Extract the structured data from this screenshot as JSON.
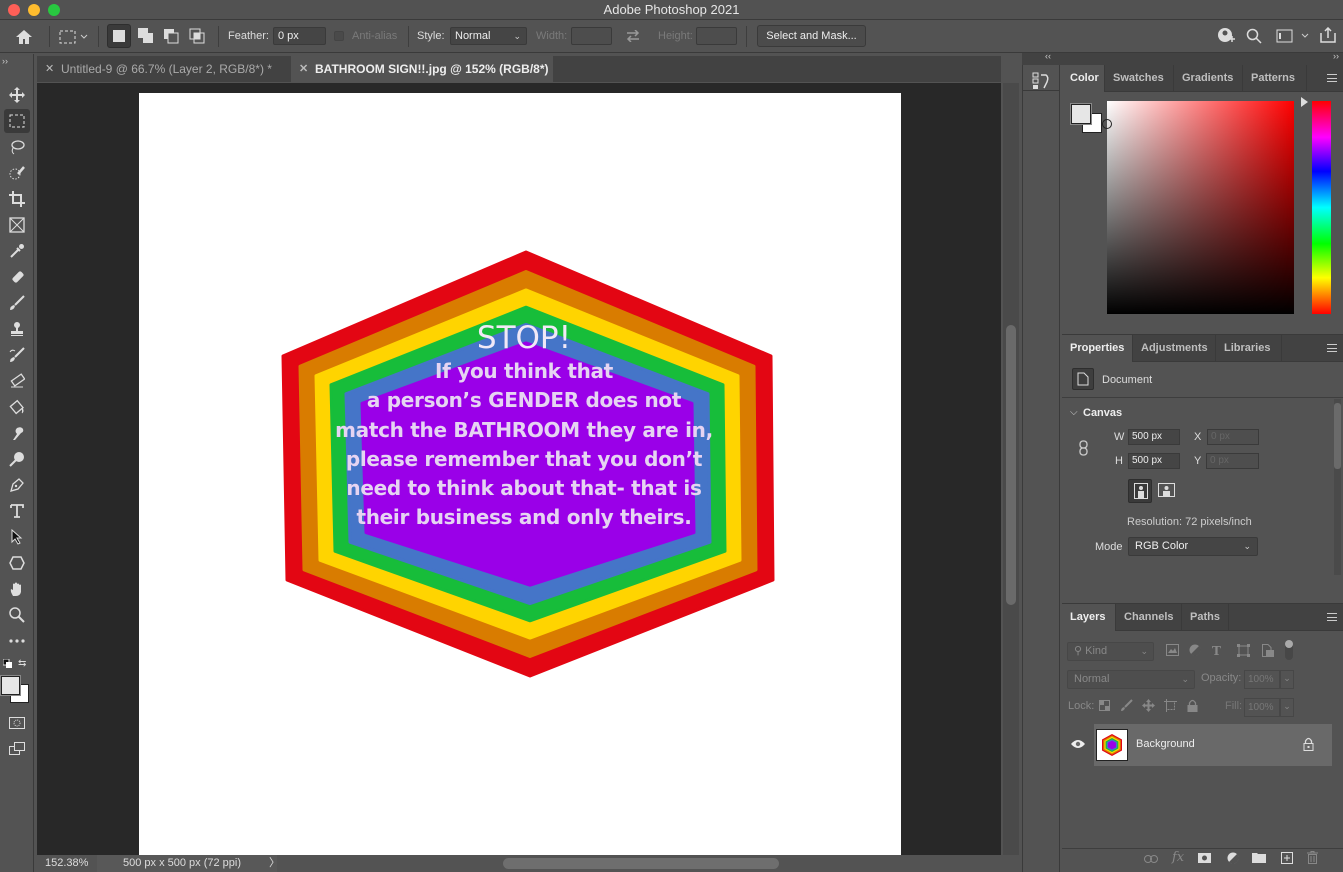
{
  "app": {
    "title": "Adobe Photoshop 2021"
  },
  "options_bar": {
    "feather_label": "Feather:",
    "feather_value": "0 px",
    "anti_alias_label": "Anti-alias",
    "style_label": "Style:",
    "style_value": "Normal",
    "width_label": "Width:",
    "height_label": "Height:",
    "select_mask_label": "Select and Mask..."
  },
  "tabs": [
    {
      "label": "Untitled-9 @ 66.7% (Layer 2, RGB/8*) *",
      "active": false
    },
    {
      "label": "BATHROOM SIGN!!.jpg @ 152% (RGB/8*)",
      "active": true
    }
  ],
  "tools": [
    "move-tool",
    "marquee-tool",
    "lasso-tool",
    "quick-selection-tool",
    "crop-tool",
    "frame-tool",
    "eyedropper-tool",
    "healing-brush-tool",
    "brush-tool",
    "clone-stamp-tool",
    "history-brush-tool",
    "eraser-tool",
    "paint-bucket-tool",
    "smudge-tool",
    "dodge-tool",
    "pen-tool",
    "type-tool",
    "path-selection-tool",
    "shape-tool",
    "hand-tool",
    "zoom-tool",
    "more-tools"
  ],
  "canvas": {
    "heading": "STOP!",
    "lines": [
      "If you think that",
      "a person’s GENDER does not",
      "match the BATHROOM they are in,",
      "please remember that you don’t",
      "need to think about that- that is",
      "their business and only theirs."
    ],
    "ring_colors": [
      "#e30613",
      "#d97c00",
      "#ffd400",
      "#17bd3a",
      "#4575c8",
      "#9a00e8"
    ],
    "text_color": "#e6d4f2"
  },
  "status": {
    "zoom": "152.38%",
    "doc_info": "500 px x 500 px (72 ppi)",
    "arrow": "〉"
  },
  "color_panel": {
    "tabs": [
      "Color",
      "Swatches",
      "Gradients",
      "Patterns"
    ],
    "hue_color": "#ff0000",
    "foreground": "#e6e6e6",
    "background": "#ffffff"
  },
  "properties_panel": {
    "tabs": [
      "Properties",
      "Adjustments",
      "Libraries"
    ],
    "doc_label": "Document",
    "section": "Canvas",
    "w_label": "W",
    "w_value": "500 px",
    "h_label": "H",
    "h_value": "500 px",
    "x_label": "X",
    "x_value": "0 px",
    "y_label": "Y",
    "y_value": "0 px",
    "resolution": "Resolution: 72 pixels/inch",
    "mode_label": "Mode",
    "mode_value": "RGB Color"
  },
  "layers_panel": {
    "tabs": [
      "Layers",
      "Channels",
      "Paths"
    ],
    "filter_kind": "Kind",
    "blend_mode": "Normal",
    "opacity_label": "Opacity:",
    "opacity_value": "100%",
    "lock_label": "Lock:",
    "fill_label": "Fill:",
    "fill_value": "100%",
    "layers": [
      {
        "name": "Background",
        "visible": true,
        "locked": true
      }
    ]
  }
}
